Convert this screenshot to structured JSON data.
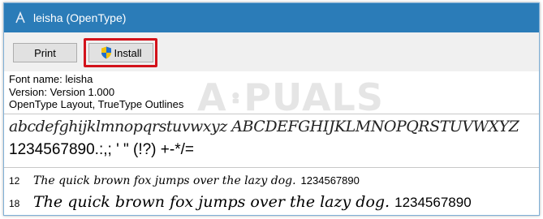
{
  "window": {
    "title": "leisha (OpenType)",
    "title_bar_color": "#2b7cb8"
  },
  "toolbar": {
    "print_label": "Print",
    "install_label": "Install",
    "highlight_color": "#d3121b"
  },
  "font_info": {
    "name_line": "Font name: leisha",
    "version_line": "Version: Version 1.000",
    "outline_line": "OpenType Layout, TrueType Outlines"
  },
  "watermark": {
    "text_left": "A",
    "text_right": "PUALS"
  },
  "preview": {
    "alphabet": "abcdefghijklmnopqrstuvwxyz ABCDEFGHIJKLMNOPQRSTUVWXYZ",
    "numbers": "1234567890.:,; ' \" (!?) +-*/="
  },
  "samples": [
    {
      "size": "12",
      "text": "The quick brown fox jumps over the lazy dog.",
      "digits": "1234567890"
    },
    {
      "size": "18",
      "text": "The quick brown fox jumps over the lazy dog.",
      "digits": "1234567890"
    }
  ]
}
